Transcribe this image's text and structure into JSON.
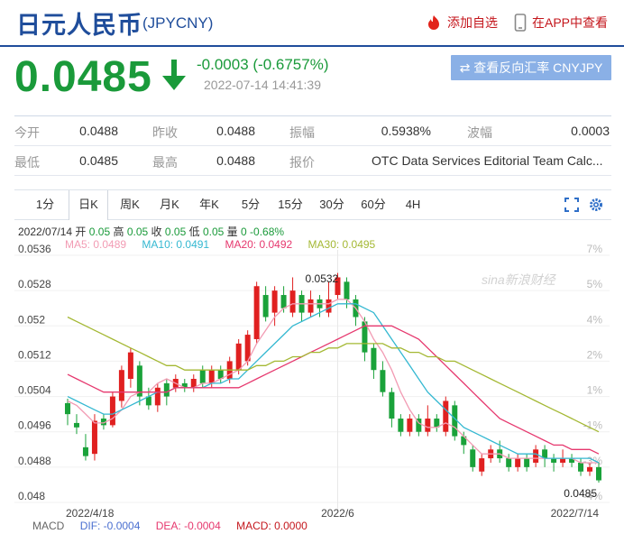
{
  "header": {
    "title": "日元人民币",
    "code": "(JPYCNY)",
    "add_favorite": "添加自选",
    "app_view": "在APP中查看"
  },
  "quote": {
    "price": "0.0485",
    "change": "-0.0003 (-0.6757%)",
    "time": "2022-07-14 14:41:39",
    "reverse_button": "查看反向汇率 CNYJPY"
  },
  "stats": [
    [
      {
        "label": "今开",
        "value": "0.0488"
      },
      {
        "label": "昨收",
        "value": "0.0488"
      },
      {
        "label": "振幅",
        "value": "0.5938%"
      },
      {
        "label": "波幅",
        "value": "0.0003"
      }
    ],
    [
      {
        "label": "最低",
        "value": "0.0485"
      },
      {
        "label": "最高",
        "value": "0.0488"
      },
      {
        "label": "报价",
        "value": "OTC Data Services Editorial Team Calc..."
      }
    ]
  ],
  "tabs": [
    "1分",
    "日K",
    "周K",
    "月K",
    "年K",
    "5分",
    "15分",
    "30分",
    "60分",
    "4H"
  ],
  "active_tab": 1,
  "info_line": {
    "date": "2022/07/14",
    "kai_label": "开",
    "kai": "0.05",
    "gao_label": "高",
    "gao": "0.05",
    "shou_label": "收",
    "shou": "0.05",
    "di_label": "低",
    "di": "0.05",
    "liang_label": "量",
    "liang": "0",
    "pct": "-0.68%"
  },
  "ma_legend": [
    {
      "text": "MA5: 0.0489",
      "color": "#f29bb3"
    },
    {
      "text": "MA10: 0.0491",
      "color": "#34b8d1"
    },
    {
      "text": "MA20: 0.0492",
      "color": "#e6386e"
    },
    {
      "text": "MA30: 0.0495",
      "color": "#a4b833"
    }
  ],
  "macd": {
    "title": "MACD",
    "dif": "DIF: -0.0004",
    "dea": "DEA: -0.0004",
    "macd": "MACD: 0.0000",
    "colors": {
      "title": "#666",
      "dif": "#4a6fd0",
      "dea": "#e6386e",
      "macd": "#c4161c"
    }
  },
  "watermark": "sina新浪财经",
  "colors": {
    "up": "#e02020",
    "down": "#1aa23a",
    "brand": "#1f4d9b"
  },
  "chart_data": {
    "type": "candlestick",
    "ylim": [
      0.048,
      0.0536
    ],
    "y_ticks": [
      "0.0536",
      "0.0528",
      "0.052",
      "0.0512",
      "0.0504",
      "0.0496",
      "0.0488",
      "0.048"
    ],
    "pct_ticks": [
      "7%",
      "5%",
      "4%",
      "2%",
      "1%",
      "-1%",
      "-3%",
      "-4%"
    ],
    "x_labels": [
      {
        "text": "2022/4/18",
        "index": 0
      },
      {
        "text": "2022/6",
        "index": 30
      },
      {
        "text": "2022/7/14",
        "index": 59
      }
    ],
    "annotations": [
      {
        "text": "0.0532",
        "index": 27
      },
      {
        "text": "0.0485",
        "index": 59
      }
    ],
    "candles": [
      {
        "o": 0.05025,
        "c": 0.05,
        "h": 0.05035,
        "l": 0.04975
      },
      {
        "o": 0.0498,
        "c": 0.0497,
        "h": 0.05,
        "l": 0.04955
      },
      {
        "o": 0.04925,
        "c": 0.04905,
        "h": 0.04955,
        "l": 0.04895
      },
      {
        "o": 0.0491,
        "c": 0.04985,
        "h": 0.05,
        "l": 0.04895
      },
      {
        "o": 0.0499,
        "c": 0.04975,
        "h": 0.05,
        "l": 0.04965
      },
      {
        "o": 0.04975,
        "c": 0.0504,
        "h": 0.0505,
        "l": 0.0497
      },
      {
        "o": 0.0503,
        "c": 0.051,
        "h": 0.0511,
        "l": 0.05015
      },
      {
        "o": 0.0508,
        "c": 0.0514,
        "h": 0.0515,
        "l": 0.0506
      },
      {
        "o": 0.0511,
        "c": 0.0504,
        "h": 0.0512,
        "l": 0.0502
      },
      {
        "o": 0.0504,
        "c": 0.0502,
        "h": 0.0506,
        "l": 0.0501
      },
      {
        "o": 0.0502,
        "c": 0.0506,
        "h": 0.0507,
        "l": 0.05005
      },
      {
        "o": 0.0507,
        "c": 0.0504,
        "h": 0.0508,
        "l": 0.0502
      },
      {
        "o": 0.0506,
        "c": 0.0508,
        "h": 0.0509,
        "l": 0.0505
      },
      {
        "o": 0.0507,
        "c": 0.0506,
        "h": 0.0508,
        "l": 0.0505
      },
      {
        "o": 0.0506,
        "c": 0.0508,
        "h": 0.0509,
        "l": 0.0505
      },
      {
        "o": 0.051,
        "c": 0.0507,
        "h": 0.0511,
        "l": 0.0506
      },
      {
        "o": 0.0507,
        "c": 0.051,
        "h": 0.0511,
        "l": 0.0506
      },
      {
        "o": 0.051,
        "c": 0.0508,
        "h": 0.0511,
        "l": 0.0507
      },
      {
        "o": 0.0508,
        "c": 0.0512,
        "h": 0.0513,
        "l": 0.0507
      },
      {
        "o": 0.051,
        "c": 0.0516,
        "h": 0.0517,
        "l": 0.0509
      },
      {
        "o": 0.0512,
        "c": 0.0518,
        "h": 0.0519,
        "l": 0.0511
      },
      {
        "o": 0.0517,
        "c": 0.0529,
        "h": 0.053,
        "l": 0.0516
      },
      {
        "o": 0.0527,
        "c": 0.0522,
        "h": 0.0529,
        "l": 0.0521
      },
      {
        "o": 0.0523,
        "c": 0.0528,
        "h": 0.0529,
        "l": 0.052
      },
      {
        "o": 0.0527,
        "c": 0.0524,
        "h": 0.0529,
        "l": 0.0523
      },
      {
        "o": 0.0523,
        "c": 0.0528,
        "h": 0.0531,
        "l": 0.0522
      },
      {
        "o": 0.0527,
        "c": 0.0523,
        "h": 0.0528,
        "l": 0.0521
      },
      {
        "o": 0.0523,
        "c": 0.0526,
        "h": 0.0528,
        "l": 0.0522
      },
      {
        "o": 0.0526,
        "c": 0.0524,
        "h": 0.0527,
        "l": 0.0522
      },
      {
        "o": 0.0523,
        "c": 0.0526,
        "h": 0.053,
        "l": 0.0522
      },
      {
        "o": 0.0527,
        "c": 0.0531,
        "h": 0.0532,
        "l": 0.0526
      },
      {
        "o": 0.053,
        "c": 0.0526,
        "h": 0.0531,
        "l": 0.0524
      },
      {
        "o": 0.0526,
        "c": 0.0522,
        "h": 0.0527,
        "l": 0.052
      },
      {
        "o": 0.0521,
        "c": 0.0514,
        "h": 0.0522,
        "l": 0.0512
      },
      {
        "o": 0.0515,
        "c": 0.051,
        "h": 0.0516,
        "l": 0.0508
      },
      {
        "o": 0.051,
        "c": 0.0505,
        "h": 0.0512,
        "l": 0.0504
      },
      {
        "o": 0.0505,
        "c": 0.0499,
        "h": 0.0506,
        "l": 0.0497
      },
      {
        "o": 0.0499,
        "c": 0.0496,
        "h": 0.05,
        "l": 0.0495
      },
      {
        "o": 0.0496,
        "c": 0.0499,
        "h": 0.05,
        "l": 0.0495
      },
      {
        "o": 0.0499,
        "c": 0.0496,
        "h": 0.05,
        "l": 0.0495
      },
      {
        "o": 0.0496,
        "c": 0.0499,
        "h": 0.0502,
        "l": 0.0495
      },
      {
        "o": 0.0499,
        "c": 0.0497,
        "h": 0.05,
        "l": 0.0496
      },
      {
        "o": 0.0496,
        "c": 0.0503,
        "h": 0.0504,
        "l": 0.0495
      },
      {
        "o": 0.0502,
        "c": 0.0495,
        "h": 0.0503,
        "l": 0.0494
      },
      {
        "o": 0.0495,
        "c": 0.0493,
        "h": 0.0496,
        "l": 0.0491
      },
      {
        "o": 0.0492,
        "c": 0.0488,
        "h": 0.0493,
        "l": 0.0487
      },
      {
        "o": 0.0487,
        "c": 0.049,
        "h": 0.0491,
        "l": 0.0486
      },
      {
        "o": 0.049,
        "c": 0.0492,
        "h": 0.0493,
        "l": 0.0489
      },
      {
        "o": 0.0492,
        "c": 0.049,
        "h": 0.0494,
        "l": 0.0489
      },
      {
        "o": 0.049,
        "c": 0.0488,
        "h": 0.0491,
        "l": 0.0487
      },
      {
        "o": 0.0488,
        "c": 0.049,
        "h": 0.0491,
        "l": 0.0487
      },
      {
        "o": 0.049,
        "c": 0.0488,
        "h": 0.0491,
        "l": 0.0487
      },
      {
        "o": 0.0489,
        "c": 0.0492,
        "h": 0.0493,
        "l": 0.0488
      },
      {
        "o": 0.0492,
        "c": 0.049,
        "h": 0.0493,
        "l": 0.0488
      },
      {
        "o": 0.049,
        "c": 0.0489,
        "h": 0.0491,
        "l": 0.0487
      },
      {
        "o": 0.0489,
        "c": 0.049,
        "h": 0.0492,
        "l": 0.0488
      },
      {
        "o": 0.049,
        "c": 0.0489,
        "h": 0.0491,
        "l": 0.0488
      },
      {
        "o": 0.0489,
        "c": 0.0487,
        "h": 0.049,
        "l": 0.0486
      },
      {
        "o": 0.0487,
        "c": 0.0488,
        "h": 0.0489,
        "l": 0.0486
      },
      {
        "o": 0.0488,
        "c": 0.0485,
        "h": 0.0489,
        "l": 0.04845
      }
    ],
    "series": [
      {
        "name": "MA5",
        "color": "#f29bb3",
        "values": [
          0.0503,
          0.0502,
          0.05,
          0.0498,
          0.0498,
          0.0499,
          0.0501,
          0.0504,
          0.0505,
          0.0505,
          0.0507,
          0.0508,
          0.0507,
          0.0506,
          0.0506,
          0.0507,
          0.0507,
          0.0508,
          0.0509,
          0.051,
          0.0512,
          0.0516,
          0.0519,
          0.0522,
          0.0524,
          0.0525,
          0.0525,
          0.0525,
          0.0525,
          0.0525,
          0.0526,
          0.0526,
          0.0524,
          0.0521,
          0.0517,
          0.0514,
          0.051,
          0.0505,
          0.0501,
          0.0498,
          0.0497,
          0.0497,
          0.0498,
          0.0497,
          0.0495,
          0.0493,
          0.0491,
          0.0491,
          0.0491,
          0.049,
          0.049,
          0.049,
          0.049,
          0.049,
          0.049,
          0.049,
          0.049,
          0.0489,
          0.0489,
          0.0489
        ]
      },
      {
        "name": "MA10",
        "color": "#34b8d1",
        "values": [
          0.0504,
          0.0503,
          0.0502,
          0.0501,
          0.05,
          0.05,
          0.0501,
          0.0502,
          0.0503,
          0.0504,
          0.0505,
          0.0505,
          0.0506,
          0.0506,
          0.0506,
          0.0506,
          0.0507,
          0.0507,
          0.0508,
          0.0508,
          0.051,
          0.0512,
          0.0514,
          0.0516,
          0.0518,
          0.052,
          0.0521,
          0.0522,
          0.0523,
          0.0524,
          0.0525,
          0.0525,
          0.0525,
          0.0524,
          0.0523,
          0.052,
          0.0517,
          0.0514,
          0.0511,
          0.0508,
          0.0505,
          0.0503,
          0.0501,
          0.0499,
          0.0497,
          0.0496,
          0.0495,
          0.0494,
          0.0493,
          0.0492,
          0.0491,
          0.0491,
          0.0491,
          0.049,
          0.049,
          0.049,
          0.049,
          0.049,
          0.049,
          0.0489
        ]
      },
      {
        "name": "MA20",
        "color": "#e6386e",
        "values": [
          0.0509,
          0.0508,
          0.0507,
          0.0506,
          0.0505,
          0.0505,
          0.0505,
          0.0505,
          0.0505,
          0.0505,
          0.0505,
          0.0505,
          0.0506,
          0.0506,
          0.0506,
          0.0506,
          0.0506,
          0.0506,
          0.0506,
          0.0506,
          0.0507,
          0.0508,
          0.0509,
          0.051,
          0.0511,
          0.0512,
          0.0513,
          0.0514,
          0.0515,
          0.0516,
          0.0517,
          0.0518,
          0.0519,
          0.052,
          0.052,
          0.052,
          0.052,
          0.0519,
          0.0518,
          0.0517,
          0.0515,
          0.0513,
          0.0511,
          0.0509,
          0.0507,
          0.0505,
          0.0503,
          0.0501,
          0.0499,
          0.0498,
          0.0497,
          0.0496,
          0.0495,
          0.0494,
          0.0493,
          0.0493,
          0.0492,
          0.0492,
          0.0492,
          0.0491
        ]
      },
      {
        "name": "MA30",
        "color": "#a4b833",
        "values": [
          0.0522,
          0.0521,
          0.052,
          0.0519,
          0.0518,
          0.0517,
          0.0516,
          0.0515,
          0.0514,
          0.0513,
          0.0512,
          0.0511,
          0.0511,
          0.051,
          0.051,
          0.051,
          0.051,
          0.051,
          0.051,
          0.051,
          0.051,
          0.0511,
          0.0511,
          0.0512,
          0.0512,
          0.0513,
          0.0513,
          0.0514,
          0.0514,
          0.0515,
          0.0515,
          0.0516,
          0.0516,
          0.0516,
          0.0516,
          0.0516,
          0.0515,
          0.0515,
          0.0514,
          0.0514,
          0.0513,
          0.0513,
          0.0512,
          0.0512,
          0.0511,
          0.051,
          0.0509,
          0.0508,
          0.0507,
          0.0506,
          0.0505,
          0.0504,
          0.0503,
          0.0502,
          0.0501,
          0.05,
          0.0499,
          0.0498,
          0.0497,
          0.0496
        ]
      }
    ]
  }
}
